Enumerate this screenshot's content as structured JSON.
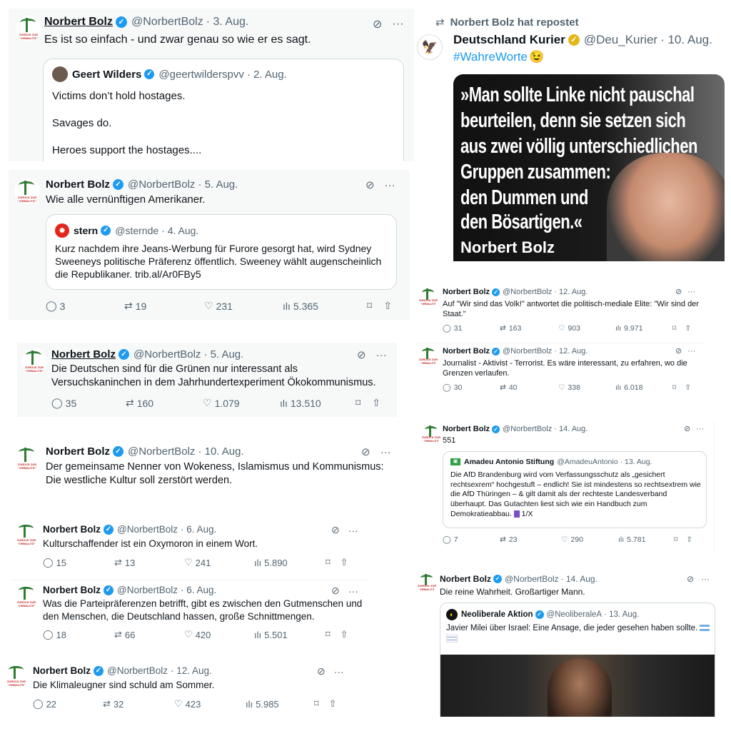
{
  "tweets": {
    "t1": {
      "name": "Norbert Bolz",
      "handle": "@NorbertBolz",
      "date": "· 3. Aug.",
      "text": "Es ist so einfach - und zwar genau so wie er es sagt.",
      "quote": {
        "name": "Geert Wilders",
        "handle": "@geertwilderspvv",
        "date": "· 2. Aug.",
        "lines": [
          "Victims don’t hold hostages.",
          "Savages do.",
          "Heroes support the hostages...."
        ]
      }
    },
    "t2": {
      "name": "Norbert Bolz",
      "handle": "@NorbertBolz",
      "date": "· 5. Aug.",
      "text": "Wie alle vernünftigen Amerikaner.",
      "quote": {
        "name": "stern",
        "handle": "@sternde",
        "date": "· 4. Aug.",
        "text": "Kurz nachdem ihre Jeans-Werbung für Furore gesorgt hat, wird Sydney Sweeneys politische Präferenz öffentlich. Sweeney wählt augenscheinlich die Republikaner. trib.al/Ar0FBy5"
      },
      "stats": {
        "replies": "3",
        "reposts": "19",
        "likes": "231",
        "views": "5.365"
      }
    },
    "t3": {
      "name": "Norbert Bolz",
      "handle": "@NorbertBolz",
      "date": "· 5. Aug.",
      "text": "Die Deutschen sind für die Grünen nur interessant als Versuchskaninchen in dem Jahrhundertexperiment Ökokommunismus.",
      "stats": {
        "replies": "35",
        "reposts": "160",
        "likes": "1.079",
        "views": "13.510"
      }
    },
    "t4": {
      "name": "Norbert Bolz",
      "handle": "@NorbertBolz",
      "date": "· 10. Aug.",
      "text": "Der gemeinsame Nenner von Wokeness, Islamismus und Kommunismus: Die westliche Kultur soll zerstört werden."
    },
    "t5": {
      "name": "Norbert Bolz",
      "handle": "@NorbertBolz",
      "date": "· 6. Aug.",
      "text": "Kulturschaffender ist ein Oxymoron in einem Wort.",
      "stats": {
        "replies": "15",
        "reposts": "13",
        "likes": "241",
        "views": "5.890"
      }
    },
    "t6": {
      "name": "Norbert Bolz",
      "handle": "@NorbertBolz",
      "date": "· 6. Aug.",
      "text": "Was die Parteipräferenzen betrifft, gibt es zwischen den Gutmenschen und den Menschen, die Deutschland hassen, große Schnittmengen.",
      "stats": {
        "replies": "18",
        "reposts": "66",
        "likes": "420",
        "views": "5.501"
      }
    },
    "t7": {
      "name": "Norbert Bolz",
      "handle": "@NorbertBolz",
      "date": "· 12. Aug.",
      "text": "Die Klimaleugner sind schuld am Sommer.",
      "stats": {
        "replies": "22",
        "reposts": "32",
        "likes": "423",
        "views": "5.985"
      }
    },
    "t8": {
      "reposted": "Norbert Bolz hat repostet",
      "name": "Deutschland Kurier",
      "handle": "@Deu_Kurier",
      "date": "· 10. Aug.",
      "hashtag": "#WahreWorte",
      "image": {
        "quote_lines": [
          "»Man sollte Linke nicht pauschal",
          "beurteilen, denn sie setzen sich",
          "aus zwei völlig unterschiedlichen",
          "Gruppen zusammen:",
          "den Dummen und",
          "den Bösartigen.«"
        ],
        "author": "Norbert Bolz"
      }
    },
    "t9": {
      "name": "Norbert Bolz",
      "handle": "@NorbertBolz",
      "date": "· 12. Aug.",
      "text": "Auf \"Wir sind das Volk!\" antwortet die politisch-mediale Elite: \"Wir sind der Staat.\"",
      "stats": {
        "replies": "31",
        "reposts": "163",
        "likes": "903",
        "views": "9.971"
      }
    },
    "t10": {
      "name": "Norbert Bolz",
      "handle": "@NorbertBolz",
      "date": "· 12. Aug.",
      "text": "Journalist -  Aktivist  - Terrorist. Es wäre interessant,  zu erfahren, wo die Grenzen verlaufen.",
      "stats": {
        "replies": "30",
        "reposts": "40",
        "likes": "338",
        "views": "6.018"
      }
    },
    "t11": {
      "name": "Norbert Bolz",
      "handle": "@NorbertBolz",
      "date": "· 14. Aug.",
      "text": "551",
      "quote": {
        "name": "Amadeu Antonio Stiftung",
        "handle": "@AmadeuAntonio",
        "date": "· 13. Aug.",
        "text": "Die AfD Brandenburg wird vom Verfassungsschutz als „gesichert rechtsexrem“ hochgestuft – endlich! Sie ist mindestens so rechtsextrem wie die AfD Thüringen – & gilt damit als der rechteste Landesverband überhaupt. Das Gutachten liest sich wie ein Handbuch zum Demokratieabbau.",
        "suffix": "1/X"
      },
      "stats": {
        "replies": "7",
        "reposts": "23",
        "likes": "290",
        "views": "5.781"
      }
    },
    "t12": {
      "name": "Norbert Bolz",
      "handle": "@NorbertBolz",
      "date": "· 14. Aug.",
      "text": "Die reine Wahrheit. Großartiger Mann.",
      "quote": {
        "name": "Neoliberale Aktion",
        "handle": "@NeoliberaleA",
        "date": "· 13. Aug.",
        "text": "Javier Milei über Israel: Eine Ansage, die jeder gesehen haben sollte."
      }
    }
  },
  "avatar_label": "ZURÜCK ZUR NORMALITÄT",
  "icons": {
    "reply": "reply-icon",
    "repost": "repost-icon",
    "like": "heart-icon",
    "views": "views-icon",
    "bookmark": "bookmark-icon",
    "share": "share-icon",
    "grok": "grok-icon",
    "more": "more-icon"
  },
  "colors": {
    "blue": "#1d9bf0",
    "gold": "#e2b719",
    "text": "#0f1419",
    "muted": "#536471",
    "border": "#cfd9de"
  }
}
